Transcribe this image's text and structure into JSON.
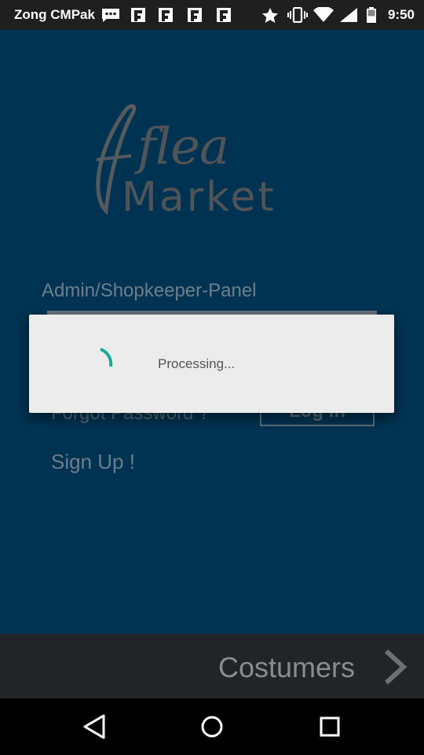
{
  "status_bar": {
    "carrier": "Zong CMPak",
    "time": "9:50",
    "icons": [
      "chat-icon",
      "flipboard-icon",
      "flipboard-icon",
      "flipboard-icon",
      "flipboard-icon",
      "star-icon",
      "vibrate-icon",
      "wifi-icon",
      "signal-icon",
      "battery-icon"
    ]
  },
  "logo": {
    "line1": "flea",
    "line2": "Market"
  },
  "login": {
    "panel_title": "Admin/Shopkeeper-Panel",
    "forgot_label": "Forgot Password ?",
    "login_label": "Log In",
    "signup_label": "Sign Up !"
  },
  "dialog": {
    "message": "Processing..."
  },
  "bottom_bar": {
    "label": "Costumers"
  },
  "colors": {
    "app_bg": "#003352",
    "spinner": "#1aa89a",
    "dialog_bg": "#ececec",
    "bottom_bar_bg": "#222427"
  }
}
